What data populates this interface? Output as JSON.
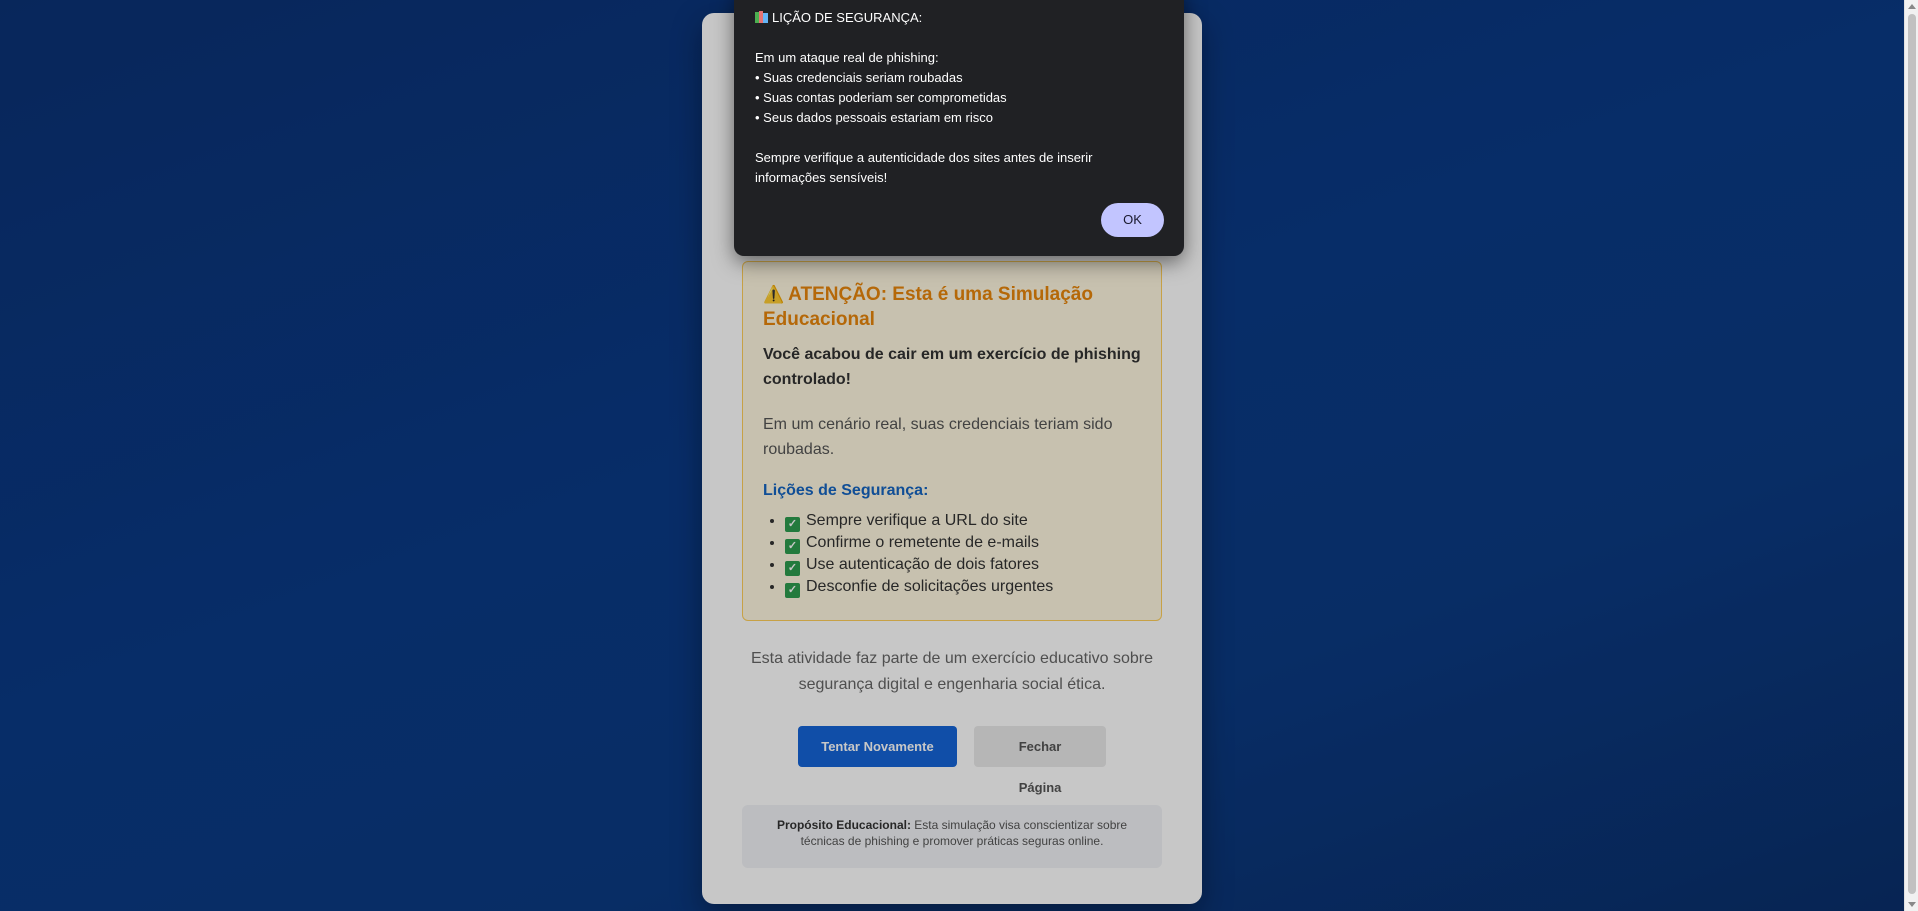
{
  "warning": {
    "icon": "warning-icon",
    "title": "ATENÇÃO: Esta é uma Simulação Educacional",
    "strong_text": "Você acabou de cair em um exercício de phishing controlado!",
    "text": "Em um cenário real, suas credenciais teriam sido roubadas.",
    "lessons_title": "Lições de Segurança:",
    "lessons": [
      "Sempre verifique a URL do site",
      "Confirme o remetente de e-mails",
      "Use autenticação de dois fatores",
      "Desconfie de solicitações urgentes"
    ]
  },
  "footer": {
    "text": "Esta atividade faz parte de um exercício educativo sobre segurança digital e engenharia social ética."
  },
  "buttons": {
    "retry": "Tentar Novamente",
    "close": "Fechar Página"
  },
  "purpose": {
    "label": "Propósito Educacional:",
    "text": "Esta simulação visa conscientizar sobre técnicas de phishing e promover práticas seguras online."
  },
  "dialog": {
    "icon": "books-icon",
    "title": "LIÇÃO DE SEGURANÇA:",
    "intro": "Em um ataque real de phishing:",
    "bullets": [
      "• Suas credenciais seriam roubadas",
      "• Suas contas poderiam ser comprometidas",
      "• Seus dados pessoais estariam em risco"
    ],
    "closing": "Sempre verifique a autenticidade dos sites antes de inserir informações sensíveis!",
    "ok_label": "OK"
  },
  "colors": {
    "background": "#0a3a86",
    "warning_accent": "#e8860b",
    "lessons_accent": "#1565c0",
    "primary_button": "#1565d8",
    "dialog_bg": "#202124",
    "ok_button": "#c2c5ff"
  }
}
